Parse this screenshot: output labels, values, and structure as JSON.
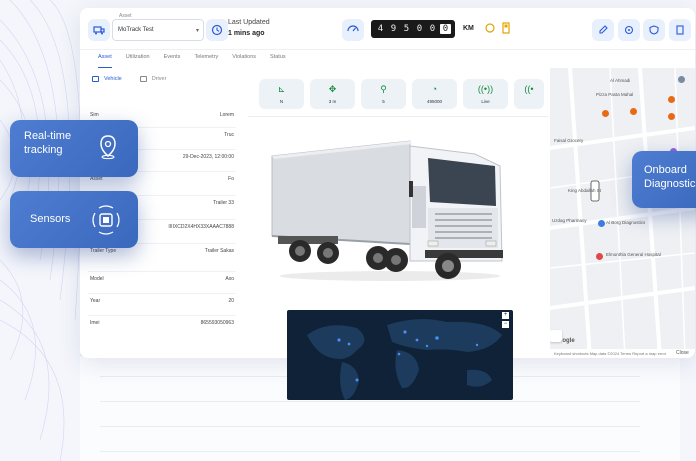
{
  "topbar": {
    "asset_select_label": "Asset",
    "asset_select_value": "MoTrack Test",
    "last_updated_label": "Last Updated",
    "last_updated_value": "1 mins ago",
    "odometer_digits": [
      "4",
      "9",
      "5",
      "0",
      "0",
      "0"
    ],
    "odometer_unit": "KM"
  },
  "tabs": [
    "Asset",
    "Utilization",
    "Events",
    "Telemetry",
    "Violations",
    "Status"
  ],
  "subtabs": [
    "Vehicle",
    "Driver"
  ],
  "asset_rows": [
    {
      "key": "Sim",
      "value": "Lorem"
    },
    {
      "key": "",
      "value": "Truc"
    },
    {
      "key": "",
      "value": "29-Dec-2023, 12:00:00"
    },
    {
      "key": "Asset",
      "value": "Fo"
    },
    {
      "key": "",
      "value": "Trailer 33"
    },
    {
      "key": "Makeid",
      "value": "IIIIXCD2X4HX33XAAAC7888"
    },
    {
      "key": "Trailer Type",
      "value": "Trailer Sakas"
    },
    {
      "key": "Model",
      "value": "Axo"
    },
    {
      "key": "Year",
      "value": "20"
    },
    {
      "key": "Imei",
      "value": "865593050963"
    }
  ],
  "sensor_chips": [
    {
      "icon": "fuel-level-icon",
      "label": "N"
    },
    {
      "icon": "gps-icon",
      "label": "3 m"
    },
    {
      "icon": "satellite-icon",
      "label": "5"
    },
    {
      "icon": "speedometer-icon",
      "label": "495000"
    },
    {
      "icon": "signal-icon",
      "label": "Live"
    },
    {
      "icon": "broadcast-icon",
      "label": ""
    }
  ],
  "map": {
    "labels": [
      "Al Ahmadi",
      "Pizza Pasta Mahal",
      "Faisal Grocery",
      "King Abdallah St",
      "Uzdag Pharmacy",
      "Al Borg Diagnostics",
      "Elmonthla General Hospital"
    ],
    "footer": "Keyboard shortcuts  Map data ©2024  Terms  Report a map error",
    "google": "Google"
  },
  "callouts": {
    "realtime": "Real-time tracking",
    "sensors": "Sensors",
    "onboard": "Onboard Diagnostics"
  },
  "close_label": "Close",
  "colors": {
    "accent": "#2a5bd7",
    "callout": "#4472c8",
    "sensor_green": "#198a3f"
  }
}
